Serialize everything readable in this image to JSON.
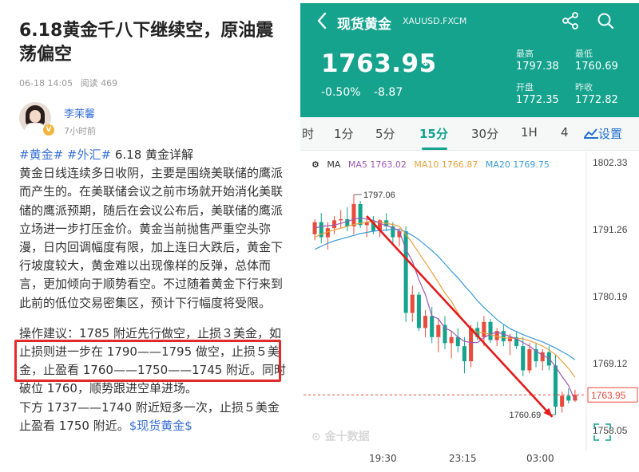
{
  "article": {
    "title": "6.18黄金千八下继续空，原油震荡偏空",
    "date": "06-18 14:05",
    "reads": "阅读 469",
    "author": "李茉馨",
    "author_time": "7小时前",
    "tag1": "#黄金#",
    "tag2": "#外汇#",
    "heading": "6.18 黄金详解",
    "para1": "黄金日线连续多日收阴，主要是围绕美联储的鹰派而产生的。在美联储会议之前市场就开始消化美联储的鹰派预期，随后在会议公布后，美联储的鹰派立场进一步打压金价。黄金当前抛售严重空头弥漫，日内回调幅度有限，加上连日大跌后，黄金下行坡度较大，黄金难以出现像样的反弹，总体而言，更加倾向于顺势看空。不过随着黄金下行来到此前的低位交易密集区，预计下行幅度将受限。",
    "para2": "操作建议：1785 附近先行做空，止损３美金，如止损则进一步在 1790——1795 做空，止损５美金，止盈看 1760——1750——1745 附近。同时破位 1760，顺势跟进空单进场。",
    "para3_a": "下方 1737——1740 附近短多一次，止损５美金止盈看 1750 附近。",
    "para3_tag": "$现货黄金$"
  },
  "app": {
    "back_icon": "chevron-left-icon",
    "title": "现货黄金",
    "symbol": "XAUUSD.FXCM",
    "price": "1763.95",
    "change_pct": "-0.50%",
    "change_abs": "-8.87",
    "stats": {
      "high_label": "最高",
      "high": "1797.38",
      "low_label": "最低",
      "low": "1760.69",
      "open_label": "开盘",
      "open": "1772.35",
      "prev_label": "昨收",
      "prev": "1772.82"
    },
    "tabs": [
      "时",
      "1分",
      "5分",
      "15分",
      "30分",
      "1H",
      "4"
    ],
    "active_tab": "15分",
    "settings_label": "设置",
    "ma": {
      "label": "MA",
      "ma5": "MA5 1763.02",
      "ma10": "MA10 1766.87",
      "ma20": "MA20 1769.75"
    },
    "colors": {
      "header": "#15a38e",
      "up": "#e74c3c",
      "down": "#15a38e",
      "ma5": "#9b59b6",
      "ma10": "#e6a23c",
      "ma20": "#3a9ad9",
      "annotation": "#e31b1b"
    }
  },
  "chart_data": {
    "type": "candlestick",
    "y_ticks": [
      "1802.33",
      "1791.26",
      "1780.19",
      "1769.12",
      "1758.05"
    ],
    "ylim": [
      1758.05,
      1802.33
    ],
    "x_ticks": [
      "19:30",
      "23:15",
      "03:00"
    ],
    "current_price_label": "1763.95",
    "high_annotation": "1797.06",
    "low_annotation": "1760.69",
    "watermark": "金十数据",
    "candles": [
      [
        1790.5,
        1793.0,
        1789.5,
        1792.5
      ],
      [
        1792.5,
        1794.0,
        1789.0,
        1790.0
      ],
      [
        1790.0,
        1792.5,
        1788.0,
        1791.5
      ],
      [
        1791.5,
        1793.5,
        1790.5,
        1792.8
      ],
      [
        1792.8,
        1794.5,
        1791.5,
        1793.0
      ],
      [
        1793.0,
        1795.0,
        1791.0,
        1791.8
      ],
      [
        1791.8,
        1797.06,
        1790.5,
        1795.5
      ],
      [
        1795.5,
        1796.0,
        1791.5,
        1792.0
      ],
      [
        1792.0,
        1793.5,
        1790.0,
        1792.5
      ],
      [
        1792.5,
        1793.5,
        1790.5,
        1791.0
      ],
      [
        1791.0,
        1793.0,
        1790.0,
        1792.8
      ],
      [
        1792.8,
        1794.0,
        1791.0,
        1791.8
      ],
      [
        1791.8,
        1792.5,
        1789.0,
        1790.0
      ],
      [
        1790.0,
        1791.5,
        1788.5,
        1791.0
      ],
      [
        1791.0,
        1791.8,
        1776.0,
        1777.5
      ],
      [
        1777.5,
        1782.0,
        1776.0,
        1780.5
      ],
      [
        1780.5,
        1781.0,
        1774.5,
        1775.0
      ],
      [
        1775.0,
        1778.0,
        1773.5,
        1777.0
      ],
      [
        1777.0,
        1778.5,
        1772.5,
        1773.5
      ],
      [
        1773.5,
        1776.5,
        1771.0,
        1775.5
      ],
      [
        1775.5,
        1777.0,
        1771.5,
        1772.5
      ],
      [
        1772.5,
        1774.5,
        1770.0,
        1773.5
      ],
      [
        1773.5,
        1775.0,
        1771.0,
        1772.0
      ],
      [
        1772.0,
        1773.5,
        1767.5,
        1769.5
      ],
      [
        1769.5,
        1775.5,
        1768.5,
        1775.0
      ],
      [
        1775.0,
        1776.0,
        1773.0,
        1773.5
      ],
      [
        1773.5,
        1777.0,
        1772.0,
        1776.0
      ],
      [
        1776.0,
        1776.5,
        1772.5,
        1773.0
      ],
      [
        1773.0,
        1775.0,
        1772.0,
        1774.5
      ],
      [
        1774.5,
        1775.5,
        1772.0,
        1772.8
      ],
      [
        1772.8,
        1774.0,
        1770.5,
        1773.5
      ],
      [
        1773.5,
        1774.5,
        1771.5,
        1772.0
      ],
      [
        1772.0,
        1773.5,
        1767.0,
        1768.0
      ],
      [
        1768.0,
        1772.5,
        1767.5,
        1771.5
      ],
      [
        1771.5,
        1772.5,
        1768.5,
        1769.5
      ],
      [
        1769.5,
        1771.5,
        1768.0,
        1771.0
      ],
      [
        1771.0,
        1772.0,
        1768.0,
        1768.8
      ],
      [
        1768.8,
        1770.5,
        1760.69,
        1762.0
      ],
      [
        1762.0,
        1764.5,
        1761.0,
        1763.8
      ],
      [
        1763.8,
        1765.0,
        1762.5,
        1763.0
      ],
      [
        1763.0,
        1764.8,
        1762.8,
        1763.95
      ]
    ],
    "ma5": [
      1791.5,
      1791.8,
      1791.9,
      1792.0,
      1792.3,
      1792.6,
      1793.0,
      1793.2,
      1793.0,
      1792.8,
      1792.3,
      1791.9,
      1791.6,
      1791.0,
      1788.0,
      1786.0,
      1783.0,
      1780.5,
      1777.0,
      1776.5,
      1775.0,
      1774.5,
      1773.5,
      1772.8,
      1772.6,
      1772.6,
      1773.4,
      1774.0,
      1774.3,
      1774.0,
      1773.6,
      1773.2,
      1772.6,
      1772.0,
      1771.2,
      1770.5,
      1770.0,
      1768.6,
      1767.0,
      1765.5,
      1763.02
    ],
    "ma10": [
      1790.0,
      1790.5,
      1790.9,
      1791.2,
      1791.5,
      1791.8,
      1792.1,
      1792.3,
      1792.5,
      1792.6,
      1792.5,
      1792.3,
      1792.1,
      1791.8,
      1790.5,
      1789.0,
      1787.4,
      1785.8,
      1784.2,
      1782.5,
      1780.8,
      1779.4,
      1777.5,
      1776.0,
      1775.0,
      1774.3,
      1774.2,
      1773.9,
      1773.6,
      1773.4,
      1773.3,
      1773.3,
      1773.2,
      1772.9,
      1772.5,
      1772.0,
      1771.4,
      1770.6,
      1769.5,
      1768.3,
      1766.87
    ],
    "ma20": [
      1788.0,
      1788.5,
      1789.0,
      1789.4,
      1789.7,
      1790.0,
      1790.3,
      1790.6,
      1790.8,
      1791.0,
      1791.1,
      1791.2,
      1791.3,
      1791.3,
      1790.9,
      1790.3,
      1789.6,
      1788.7,
      1787.8,
      1786.8,
      1785.6,
      1784.4,
      1783.3,
      1782.0,
      1780.8,
      1779.5,
      1778.4,
      1777.4,
      1776.4,
      1775.6,
      1774.9,
      1774.4,
      1773.9,
      1773.5,
      1773.1,
      1772.7,
      1772.2,
      1771.7,
      1771.1,
      1770.5,
      1769.75
    ]
  }
}
